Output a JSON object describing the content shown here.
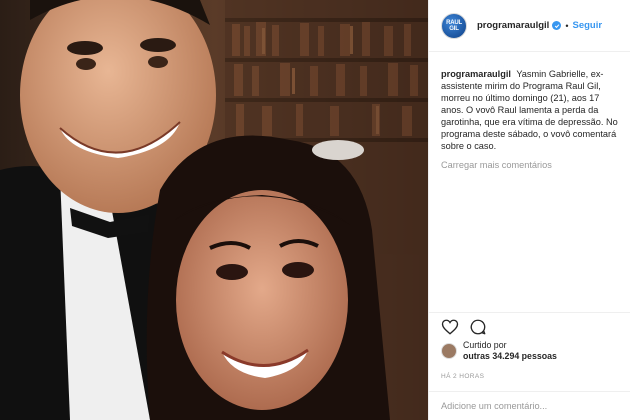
{
  "post": {
    "username": "programaraulgil",
    "follow_label": "Seguir",
    "separator": "•",
    "avatar_text": "RAUL GIL",
    "caption_username": "programaraulgil",
    "caption_text": "Yasmin Gabrielle, ex-assistente mirim do Programa Raul Gil, morreu no último domingo (21), aos 17 anos. O vovô Raul lamenta a perda da garotinha, que era vítima de depressão. No programa deste sábado, o vovô comentará sobre o caso.",
    "load_more_label": "Carregar mais comentários",
    "liked_by_prefix": "Curtido por",
    "liked_by_line2": "outras 34.294 pessoas",
    "timestamp": "HÁ 2 HORAS",
    "comment_placeholder": "Adicione um comentário..."
  },
  "icons": {
    "like": "heart-icon",
    "comment": "comment-bubble-icon",
    "verified": "verified-badge-icon"
  },
  "colors": {
    "link_blue": "#3897f0",
    "muted_gray": "#999999",
    "text": "#262626",
    "border": "#efefef"
  }
}
